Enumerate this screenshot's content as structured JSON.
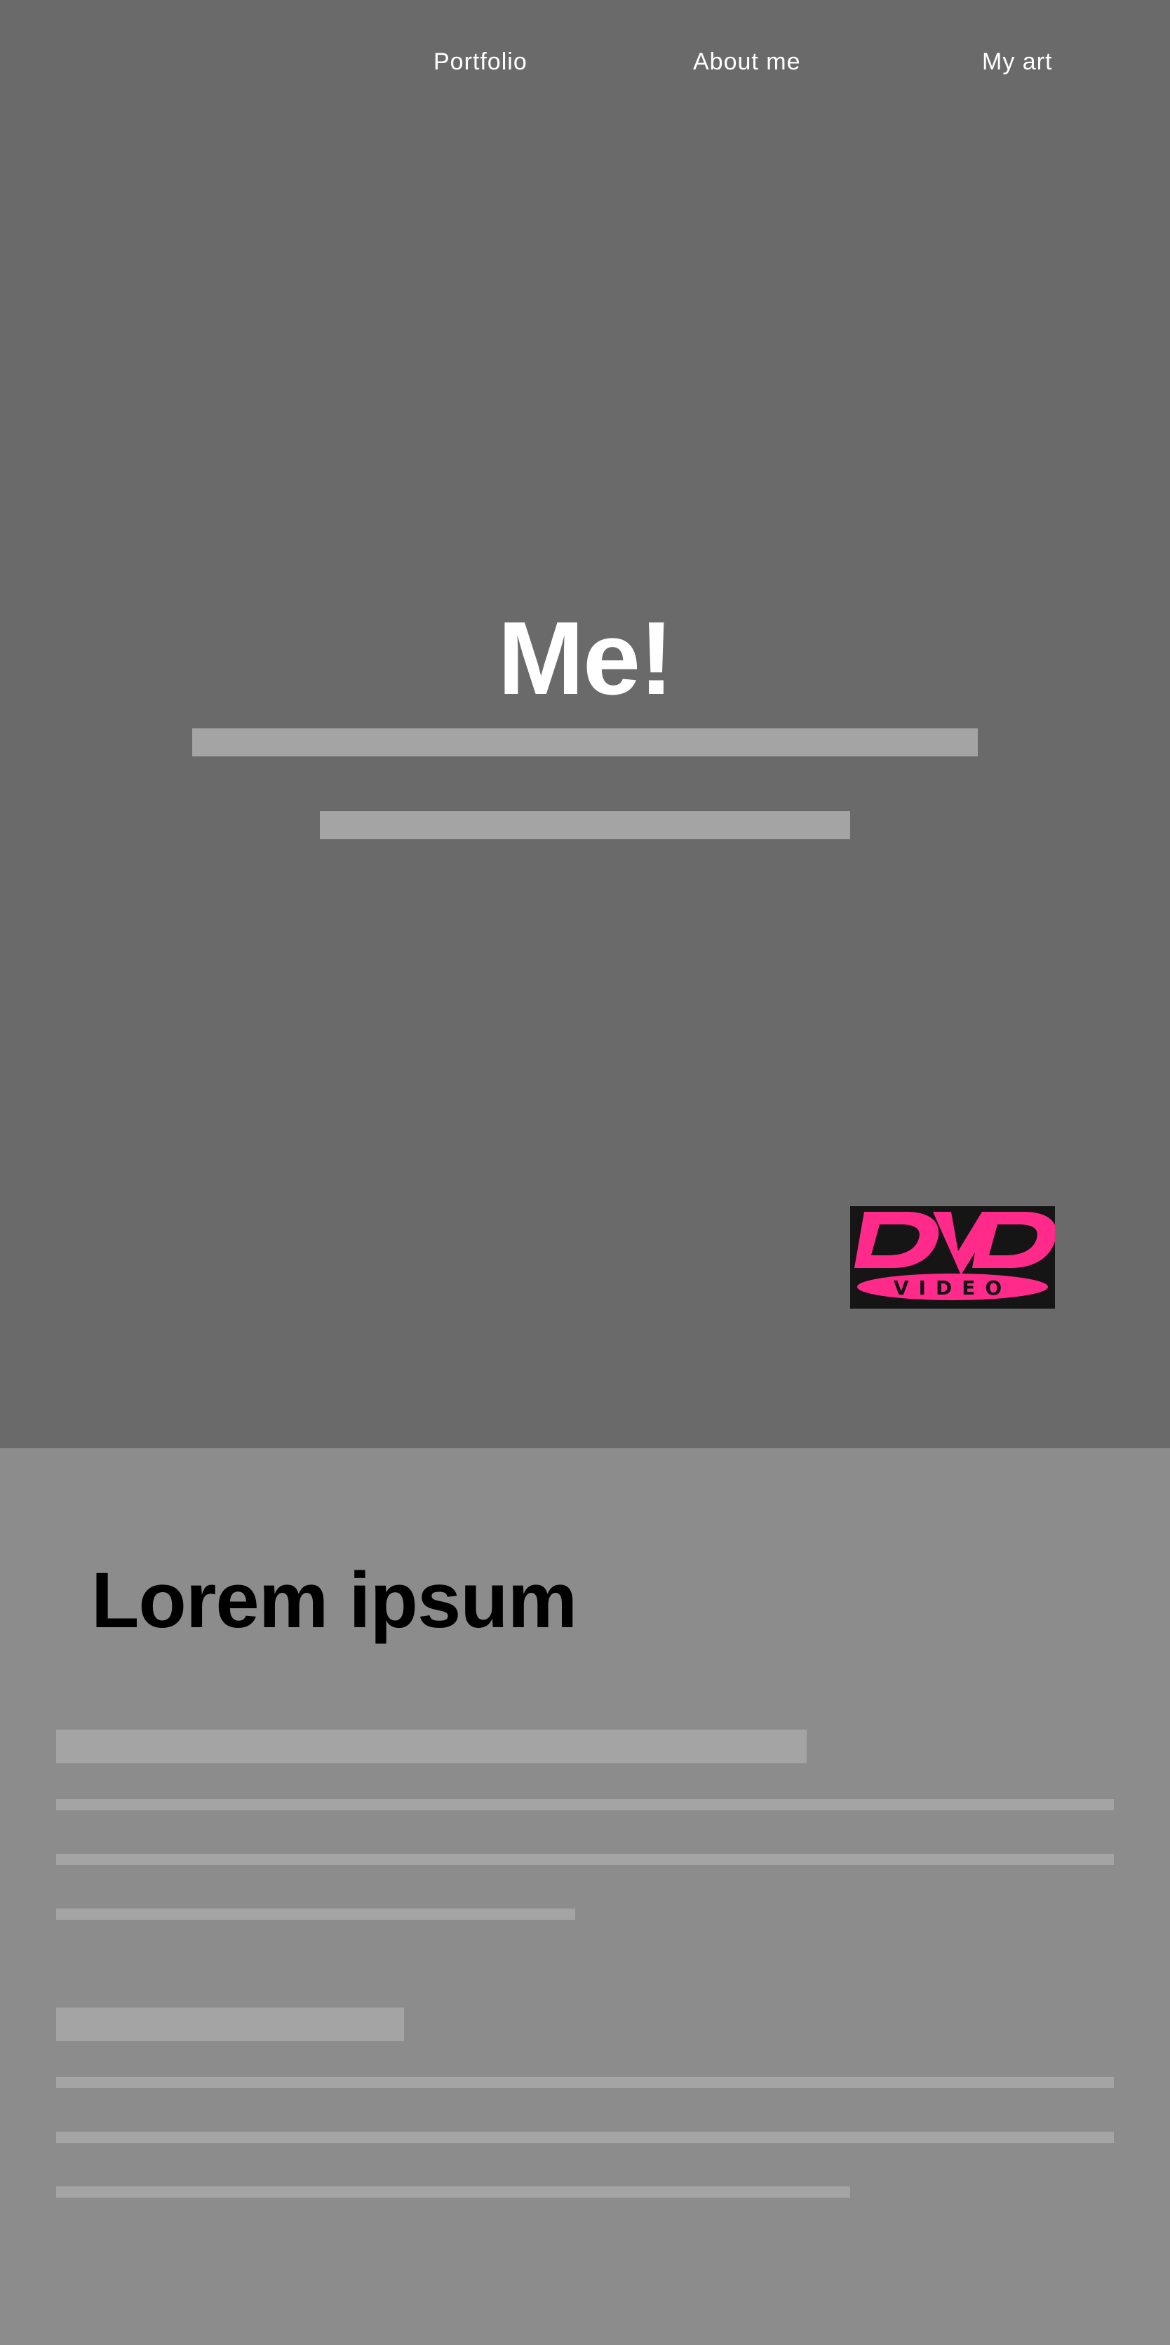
{
  "nav": {
    "items": [
      {
        "label": "Portfolio"
      },
      {
        "label": "About me"
      },
      {
        "label": "My art"
      }
    ]
  },
  "hero": {
    "title": "Me!"
  },
  "logo": {
    "wordmark": "DVD",
    "subtext": "VIDEO",
    "colors": {
      "pink": "#ff2a8a",
      "background": "#151515"
    }
  },
  "section": {
    "title": "Lorem ipsum"
  },
  "colors": {
    "hero_bg": "#6a6a6a",
    "content_bg": "#8c8c8c",
    "placeholder": "#a4a4a4",
    "hero_text": "#ffffff",
    "section_text": "#000000"
  }
}
